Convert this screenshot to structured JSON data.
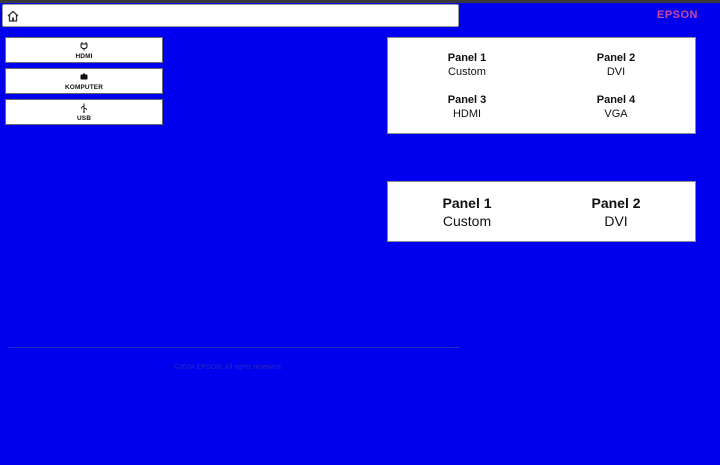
{
  "header": {
    "brand": "EPSON",
    "home_icon": "home-icon"
  },
  "sources": [
    {
      "label": "HDMI",
      "icon": "plug-icon"
    },
    {
      "label": "KOMPUTER",
      "icon": "monitor-icon"
    },
    {
      "label": "USB",
      "icon": "usb-icon"
    }
  ],
  "layout_quad": {
    "panels": [
      {
        "name": "Panel 1",
        "value": "Custom"
      },
      {
        "name": "Panel 2",
        "value": "DVI"
      },
      {
        "name": "Panel 3",
        "value": "HDMI"
      },
      {
        "name": "Panel 4",
        "value": "VGA"
      }
    ]
  },
  "layout_dual": {
    "panels": [
      {
        "name": "Panel 1",
        "value": "Custom"
      },
      {
        "name": "Panel 2",
        "value": "DVI"
      }
    ]
  },
  "footer": {
    "text": "©2024 EPSON. All rights reserved."
  },
  "colors": {
    "background": "#0000ee",
    "brand": "#c64aa6"
  }
}
